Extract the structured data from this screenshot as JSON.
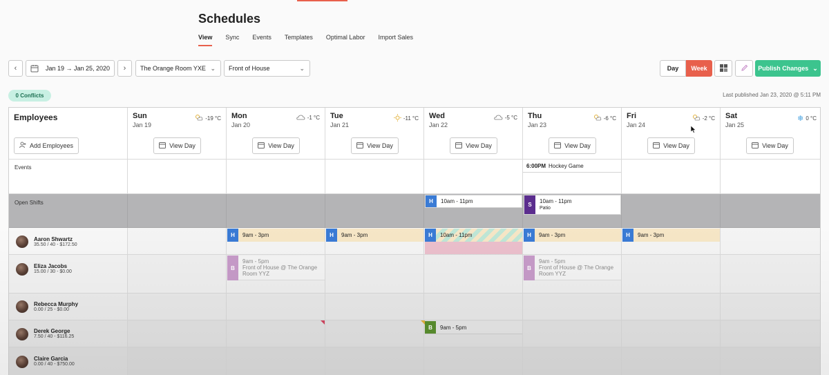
{
  "title": "Schedules",
  "tabs": [
    "View",
    "Sync",
    "Events",
    "Templates",
    "Optimal Labor",
    "Import Sales"
  ],
  "toolbar": {
    "date_range": "Jan 19 → Jan 25, 2020",
    "location": "The Orange Room YXE",
    "area": "Front of House",
    "day_label": "Day",
    "week_label": "Week",
    "publish_label": "Publish Changes"
  },
  "conflicts": "0 Conflicts",
  "last_published": "Last published Jan 23, 2020 @ 5:11 PM",
  "employees_header": "Employees",
  "add_employees": "Add Employees",
  "view_day": "View Day",
  "days": [
    {
      "name": "Sun",
      "date": "Jan 19",
      "temp": "-19 °C",
      "weather": "partly-sunny"
    },
    {
      "name": "Mon",
      "date": "Jan 20",
      "temp": "-1 °C",
      "weather": "cloudy"
    },
    {
      "name": "Tue",
      "date": "Jan 21",
      "temp": "-11 °C",
      "weather": "sunny"
    },
    {
      "name": "Wed",
      "date": "Jan 22",
      "temp": "-5 °C",
      "weather": "cloudy"
    },
    {
      "name": "Thu",
      "date": "Jan 23",
      "temp": "-6 °C",
      "weather": "partly-sunny"
    },
    {
      "name": "Fri",
      "date": "Jan 24",
      "temp": "-2 °C",
      "weather": "partly-sunny"
    },
    {
      "name": "Sat",
      "date": "Jan 25",
      "temp": "0 °C",
      "weather": "snow"
    }
  ],
  "rows": {
    "events": "Events",
    "open_shifts": "Open Shifts"
  },
  "events": {
    "thu_time": "6:00PM",
    "thu_name": "Hockey Game"
  },
  "open_shifts": {
    "wed": {
      "tag": "H",
      "time": "10am - 11pm"
    },
    "thu": {
      "tag": "S",
      "time": "10am - 11pm",
      "note": "Patio"
    }
  },
  "employees": [
    {
      "name": "Aaron Shwartz",
      "stats": "35.50 / 40 - $172.50"
    },
    {
      "name": "Eliza Jacobs",
      "stats": "15.00 / 30 - $0.00"
    },
    {
      "name": "Rebecca Murphy",
      "stats": "0.00 / 25 - $0.00"
    },
    {
      "name": "Derek George",
      "stats": "7.50 / 40 - $116.25"
    },
    {
      "name": "Claire Garcia",
      "stats": "0.00 / 40 - $750.00"
    }
  ],
  "shifts": {
    "aaron": {
      "tag": "H",
      "time": "9am - 3pm",
      "wed_time": "10am - 11pm"
    },
    "eliza": {
      "tag": "B",
      "time": "9am - 5pm",
      "place_1": "Front of House @ The Orange",
      "place_2": "Room YYZ"
    },
    "derek": {
      "tag": "B",
      "time": "9am - 5pm"
    }
  },
  "colors": {
    "accent": "#e8604c",
    "publish": "#3cc48e",
    "tag_h": "#3a7bd5",
    "tag_s": "#5b2d8e",
    "tag_b": "#5a8f2f",
    "tag_b_faded": "#c79bc9",
    "shift_bg": "#f6e6c6",
    "open_row": "#b4b4b6"
  }
}
